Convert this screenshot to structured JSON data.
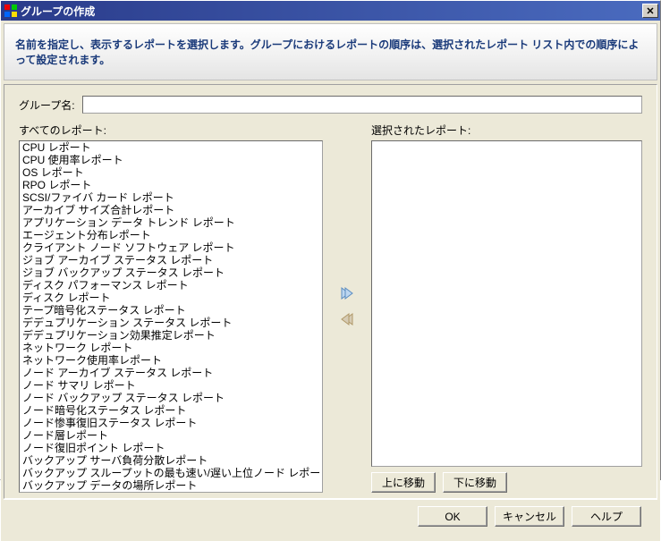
{
  "window": {
    "title": "グループの作成"
  },
  "banner": {
    "text": "名前を指定し、表示するレポートを選択します。グループにおけるレポートの順序は、選択されたレポート リスト内での順序によって設定されます。"
  },
  "group_name": {
    "label": "グループ名:",
    "value": ""
  },
  "lists": {
    "all_label": "すべてのレポート:",
    "selected_label": "選択されたレポート:",
    "all_reports": [
      "CPU レポート",
      "CPU 使用率レポート",
      "OS レポート",
      "RPO レポート",
      "SCSI/ファイバ カード レポート",
      "アーカイブ サイズ合計レポート",
      "アプリケーション データ トレンド レポート",
      "エージェント分布レポート",
      "クライアント ノード ソフトウェア レポート",
      "ジョブ アーカイブ ステータス レポート",
      "ジョブ バックアップ ステータス レポート",
      "ディスク パフォーマンス レポート",
      "ディスク レポート",
      "テープ暗号化ステータス レポート",
      "デデュプリケーション ステータス レポート",
      "デデュプリケーション効果推定レポート",
      "ネットワーク レポート",
      "ネットワーク使用率レポート",
      "ノード アーカイブ ステータス レポート",
      "ノード サマリ レポート",
      "ノード バックアップ ステータス レポート",
      "ノード暗号化ステータス レポート",
      "ノード惨事復旧ステータス レポート",
      "ノード層レポート",
      "ノード復旧ポイント レポート",
      "バックアップ サーバ負荷分散レポート",
      "バックアップ スループットの最も速い/遅い上位ノード レポート",
      "バックアップ データの場所レポート"
    ],
    "selected_reports": []
  },
  "buttons": {
    "move_up": "上に移動",
    "move_down": "下に移動",
    "ok": "OK",
    "cancel": "キャンセル",
    "help": "ヘルプ"
  }
}
